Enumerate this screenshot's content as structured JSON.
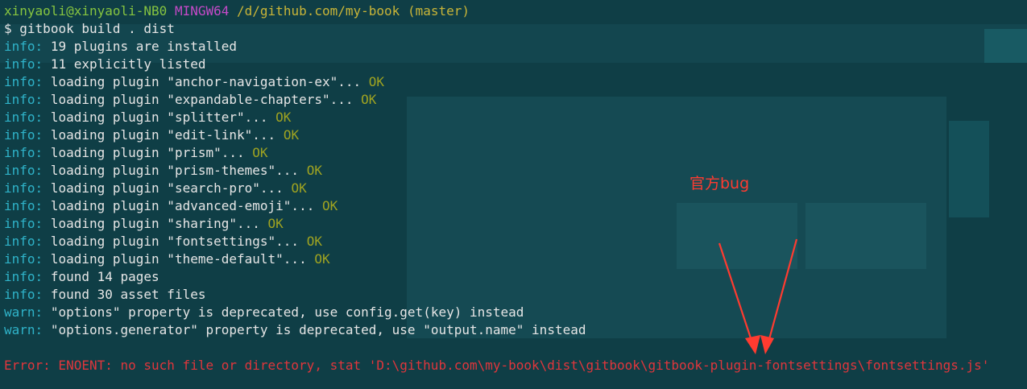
{
  "prompt": {
    "user_host": "xinyaoli@xinyaoli-NB0",
    "system": "MINGW64",
    "path": "/d/github.com/my-book",
    "branch": "(master)",
    "symbol": "$",
    "command": "gitbook build . dist"
  },
  "log": [
    {
      "level": "info:",
      "text": "19 plugins are installed",
      "status": ""
    },
    {
      "level": "info:",
      "text": "11 explicitly listed",
      "status": ""
    },
    {
      "level": "info:",
      "text": "loading plugin \"anchor-navigation-ex\"...",
      "status": "OK"
    },
    {
      "level": "info:",
      "text": "loading plugin \"expandable-chapters\"...",
      "status": "OK"
    },
    {
      "level": "info:",
      "text": "loading plugin \"splitter\"...",
      "status": "OK"
    },
    {
      "level": "info:",
      "text": "loading plugin \"edit-link\"...",
      "status": "OK"
    },
    {
      "level": "info:",
      "text": "loading plugin \"prism\"...",
      "status": "OK"
    },
    {
      "level": "info:",
      "text": "loading plugin \"prism-themes\"...",
      "status": "OK"
    },
    {
      "level": "info:",
      "text": "loading plugin \"search-pro\"...",
      "status": "OK"
    },
    {
      "level": "info:",
      "text": "loading plugin \"advanced-emoji\"...",
      "status": "OK"
    },
    {
      "level": "info:",
      "text": "loading plugin \"sharing\"...",
      "status": "OK"
    },
    {
      "level": "info:",
      "text": "loading plugin \"fontsettings\"...",
      "status": "OK"
    },
    {
      "level": "info:",
      "text": "loading plugin \"theme-default\"...",
      "status": "OK"
    },
    {
      "level": "info:",
      "text": "found 14 pages",
      "status": ""
    },
    {
      "level": "info:",
      "text": "found 30 asset files",
      "status": ""
    },
    {
      "level": "warn:",
      "text": "\"options\" property is deprecated, use config.get(key) instead",
      "status": ""
    },
    {
      "level": "warn:",
      "text": "\"options.generator\" property is deprecated, use \"output.name\" instead",
      "status": ""
    }
  ],
  "error": "Error: ENOENT: no such file or directory, stat 'D:\\github.com\\my-book\\dist\\gitbook\\gitbook-plugin-fontsettings\\fontsettings.js'",
  "annotation": {
    "label": "官方bug",
    "color": "#ff3b30"
  }
}
